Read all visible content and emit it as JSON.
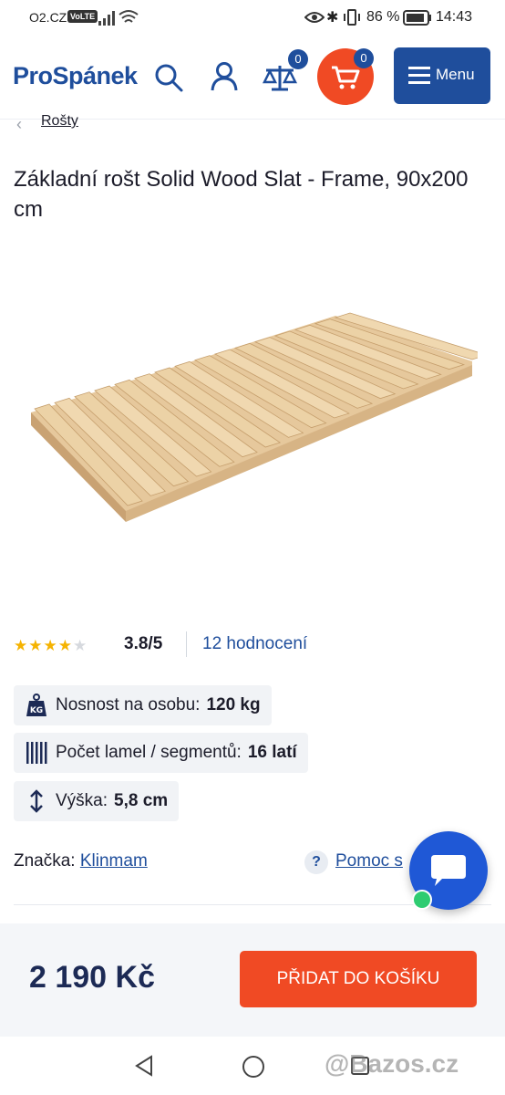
{
  "status_bar": {
    "carrier": "O2.CZ",
    "volte": "VoLTE",
    "battery": "86 %",
    "time": "14:43"
  },
  "header": {
    "logo": "ProSpánek",
    "compare_count": "0",
    "cart_count": "0",
    "menu_label": "Menu"
  },
  "breadcrumb": {
    "label": "Rošty"
  },
  "product": {
    "title": "Základní rošt Solid Wood Slat - Frame, 90x200 cm",
    "rating": {
      "stars_filled": 4,
      "stars_total": 5,
      "score": "3.8/5",
      "reviews": "12 hodnocení"
    },
    "params": [
      {
        "icon": "weight-kg-icon",
        "label": "Nosnost na osobu:",
        "value": "120 kg"
      },
      {
        "icon": "slats-icon",
        "label": "Počet lamel / segmentů:",
        "value": "16 latí"
      },
      {
        "icon": "height-arrows-icon",
        "label": "Výška:",
        "value": "5,8 cm"
      }
    ],
    "brand_label": "Značka:",
    "brand_value": "Klinmam",
    "help_label": "Pomoc s",
    "price": "2 190 Kč",
    "add_to_cart": "PŘIDAT DO KOŠÍKU"
  },
  "watermark": "@Bazos.cz",
  "colors": {
    "brand_blue": "#1f4e9c",
    "accent_orange": "#f04a24",
    "chat_blue": "#1f58d6"
  }
}
